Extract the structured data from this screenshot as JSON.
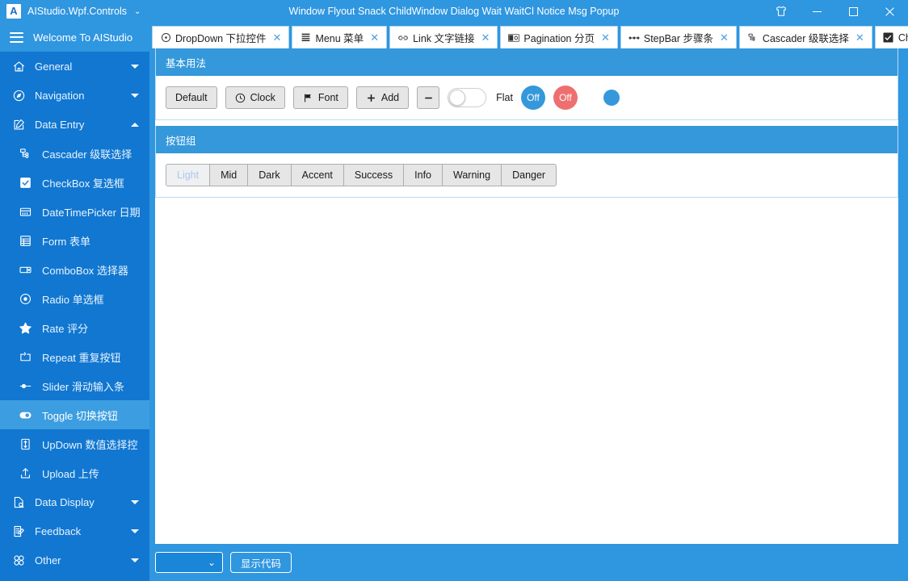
{
  "window": {
    "app_title": "AIStudio.Wpf.Controls",
    "app_logo_letter": "A",
    "center_title": "Window Flyout Snack ChildWindow Dialog Wait WaitCl Notice Msg Popup",
    "theme_icon": "shirt-icon",
    "minimize_label": "Minimize",
    "maximize_label": "Maximize",
    "close_label": "Close"
  },
  "sidebar": {
    "header": "Welcome To AIStudio",
    "menu_icon": "hamburger-icon",
    "items": [
      {
        "label": "General",
        "icon": "home-icon",
        "type": "group",
        "arrow": "down",
        "selected": false
      },
      {
        "label": "Navigation",
        "icon": "compass-icon",
        "type": "group",
        "arrow": "down",
        "selected": false
      },
      {
        "label": "Data Entry",
        "icon": "edit-square-icon",
        "type": "group",
        "arrow": "up",
        "selected": false
      },
      {
        "label": "Cascader 级联选择",
        "icon": "cascader-icon",
        "type": "item",
        "selected": false
      },
      {
        "label": "CheckBox 复选框",
        "icon": "checkbox-icon",
        "type": "item",
        "selected": false
      },
      {
        "label": "DateTimePicker 日期",
        "icon": "calendar-icon",
        "type": "item",
        "selected": false
      },
      {
        "label": "Form 表单",
        "icon": "form-icon",
        "type": "item",
        "selected": false
      },
      {
        "label": "ComboBox 选择器",
        "icon": "combobox-icon",
        "type": "item",
        "selected": false
      },
      {
        "label": "Radio 单选框",
        "icon": "radio-icon",
        "type": "item",
        "selected": false
      },
      {
        "label": "Rate 评分",
        "icon": "star-icon",
        "type": "item",
        "selected": false
      },
      {
        "label": "Repeat 重复按钮",
        "icon": "repeat-icon",
        "type": "item",
        "selected": false
      },
      {
        "label": "Slider 滑动输入条",
        "icon": "slider-icon",
        "type": "item",
        "selected": false
      },
      {
        "label": "Toggle 切换按钮",
        "icon": "toggle-icon",
        "type": "item",
        "selected": true
      },
      {
        "label": "UpDown 数值选择控",
        "icon": "updown-icon",
        "type": "item",
        "selected": false
      },
      {
        "label": "Upload 上传",
        "icon": "upload-icon",
        "type": "item",
        "selected": false
      },
      {
        "label": "Data Display",
        "icon": "data-display-icon",
        "type": "group",
        "arrow": "down",
        "selected": false
      },
      {
        "label": "Feedback",
        "icon": "feedback-icon",
        "type": "group",
        "arrow": "down",
        "selected": false
      },
      {
        "label": "Other",
        "icon": "other-icon",
        "type": "group",
        "arrow": "down",
        "selected": false
      }
    ]
  },
  "tabs": [
    {
      "label": "DropDown 下拉控件",
      "icon": "dropdown-icon",
      "closable": true
    },
    {
      "label": "Menu 菜单",
      "icon": "menu-icon",
      "closable": true
    },
    {
      "label": "Link 文字链接",
      "icon": "link-icon",
      "closable": true
    },
    {
      "label": "Pagination 分页",
      "icon": "pagination-icon",
      "closable": true
    },
    {
      "label": "StepBar 步骤条",
      "icon": "stepbar-icon",
      "closable": true
    },
    {
      "label": "Cascader 级联选择",
      "icon": "cascader-icon",
      "closable": true
    },
    {
      "label": "CheckI",
      "icon": "checkbox-icon",
      "closable": false,
      "chevron": true
    }
  ],
  "tab_close_glyph": "✕",
  "tab_chevron_glyph": "⌄",
  "panels": {
    "basic": {
      "title": "基本用法",
      "buttons": [
        {
          "label": "Default",
          "icon": null
        },
        {
          "label": "Clock",
          "icon": "clock-icon"
        },
        {
          "label": "Font",
          "icon": "flag-icon"
        },
        {
          "label": "Add",
          "icon": "plus-icon"
        }
      ],
      "minus_button": {
        "label": "−",
        "icon": "minus-icon"
      },
      "toggle_switch": {
        "state": "off"
      },
      "flat_label": "Flat",
      "round_buttons": [
        {
          "label": "Off",
          "color": "#3498db"
        },
        {
          "label": "Off",
          "color": "#ee6f6f"
        }
      ],
      "dot_button": {
        "color": "#3498db"
      }
    },
    "group": {
      "title": "按钮组",
      "buttons": [
        {
          "label": "Light",
          "disabled": true
        },
        {
          "label": "Mid",
          "disabled": false
        },
        {
          "label": "Dark",
          "disabled": false
        },
        {
          "label": "Accent",
          "disabled": false
        },
        {
          "label": "Success",
          "disabled": false
        },
        {
          "label": "Info",
          "disabled": false
        },
        {
          "label": "Warning",
          "disabled": false
        },
        {
          "label": "Danger",
          "disabled": false
        }
      ]
    }
  },
  "bottombar": {
    "combo_value": "",
    "combo_chevron": "⌄",
    "show_code_label": "显示代码"
  },
  "colors": {
    "titlebar": "#2f96e0",
    "sidebar": "#1177d1",
    "sidebar_selected": "#3c9ee0",
    "panel_header": "#3498db",
    "accent": "#3498db",
    "danger": "#ee6f6f"
  }
}
